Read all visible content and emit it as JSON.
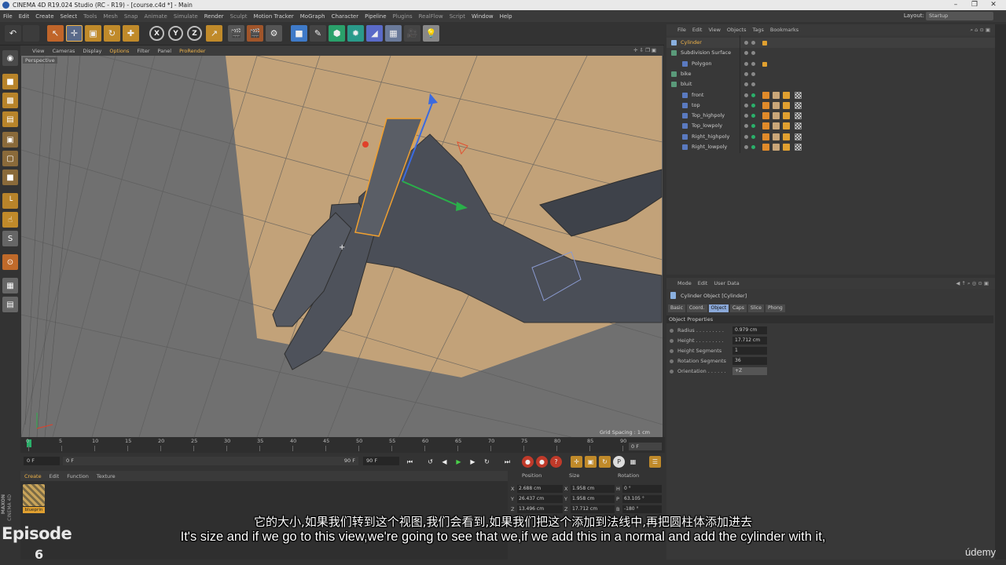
{
  "window": {
    "title": "CINEMA 4D R19.024 Studio (RC - R19) - [course.c4d *] - Main",
    "controls": [
      "–",
      "❐",
      "✕"
    ]
  },
  "menubar": {
    "items": [
      "File",
      "Edit",
      "Create",
      "Select",
      "Tools",
      "Mesh",
      "Snap",
      "Animate",
      "Simulate",
      "Render",
      "Sculpt",
      "Motion Tracker",
      "MoGraph",
      "Character",
      "Pipeline",
      "Plugins",
      "RealFlow",
      "Script",
      "Window",
      "Help"
    ],
    "layout_label": "Layout:",
    "layout_value": "Startup"
  },
  "toolbar": {
    "axis_x": "X",
    "axis_y": "Y",
    "axis_z": "Z"
  },
  "viewport": {
    "menu": [
      "View",
      "Cameras",
      "Display",
      "Options",
      "Filter",
      "Panel",
      "ProRender"
    ],
    "label": "Perspective",
    "grid_spacing": "Grid Spacing : 1 cm"
  },
  "timeline": {
    "ticks": [
      "0",
      "5",
      "10",
      "15",
      "20",
      "25",
      "30",
      "35",
      "40",
      "45",
      "50",
      "55",
      "60",
      "65",
      "70",
      "75",
      "80",
      "85",
      "90"
    ],
    "frame_field": "0 F",
    "start_field": "0 F",
    "min_field": "0 F",
    "max_field": "90 F",
    "end_field": "90 F"
  },
  "material_manager": {
    "menu": [
      "Create",
      "Edit",
      "Function",
      "Texture"
    ],
    "material_name": "blueprin"
  },
  "coordinates": {
    "headers": [
      "Position",
      "Size",
      "Rotation"
    ],
    "rows": [
      {
        "axis": "X",
        "pos": "2.688 cm",
        "size_axis": "X",
        "size": "1.958 cm",
        "rot_axis": "H",
        "rot": "0 °"
      },
      {
        "axis": "Y",
        "pos": "26.437 cm",
        "size_axis": "Y",
        "size": "1.958 cm",
        "rot_axis": "P",
        "rot": "63.105 °"
      },
      {
        "axis": "Z",
        "pos": "13.496 cm",
        "size_axis": "Z",
        "size": "17.712 cm",
        "rot_axis": "B",
        "rot": "-180 °"
      }
    ]
  },
  "brand": {
    "maxon": "MAXON",
    "cinema": "CINEMA 4D",
    "episode_label": "Episode",
    "episode_number": "6"
  },
  "object_manager": {
    "menu": [
      "File",
      "Edit",
      "View",
      "Objects",
      "Tags",
      "Bookmarks"
    ],
    "objects": [
      {
        "name": "Cylinder",
        "indent": 1,
        "selected": true
      },
      {
        "name": "Subdivision Surface",
        "indent": 1,
        "selected": false
      },
      {
        "name": "Polygon",
        "indent": 2,
        "selected": false
      },
      {
        "name": "bike",
        "indent": 1,
        "selected": false
      },
      {
        "name": "bluit",
        "indent": 1,
        "selected": false
      },
      {
        "name": "front",
        "indent": 2,
        "selected": false
      },
      {
        "name": "top",
        "indent": 2,
        "selected": false
      },
      {
        "name": "Top_highpoly",
        "indent": 2,
        "selected": false
      },
      {
        "name": "Top_lowpoly",
        "indent": 2,
        "selected": false
      },
      {
        "name": "Right_highpoly",
        "indent": 2,
        "selected": false
      },
      {
        "name": "Right_lowpoly",
        "indent": 2,
        "selected": false
      }
    ]
  },
  "attribute_manager": {
    "menu": [
      "Mode",
      "Edit",
      "User Data"
    ],
    "title": "Cylinder Object [Cylinder]",
    "tabs": [
      "Basic",
      "Coord.",
      "Object",
      "Caps",
      "Slice",
      "Phong"
    ],
    "active_tab": "Object",
    "section": "Object Properties",
    "properties": [
      {
        "label": "Radius . . . . . . . . .",
        "value": "0.979 cm"
      },
      {
        "label": "Height . . . . . . . . .",
        "value": "17.712 cm"
      },
      {
        "label": "Height Segments",
        "value": "1"
      },
      {
        "label": "Rotation Segments",
        "value": "36"
      },
      {
        "label": "Orientation . . . . . .",
        "value": "+Z"
      }
    ]
  },
  "subtitles": {
    "zh": "它的大小,如果我们转到这个视图,我们会看到,如果我们把这个添加到法线中,再把圆柱体添加进去",
    "en": "It's size and if we go to this view,we're going to see that we,if we add this in a normal and add the cylinder with it,"
  },
  "watermark": "údemy",
  "colors": {
    "accent_orange": "#f0b44a",
    "ui_bg": "#333333",
    "viewport_bg": "#707070",
    "model_gray": "#4a4e57",
    "blueprint_plane": "#c9a679"
  }
}
